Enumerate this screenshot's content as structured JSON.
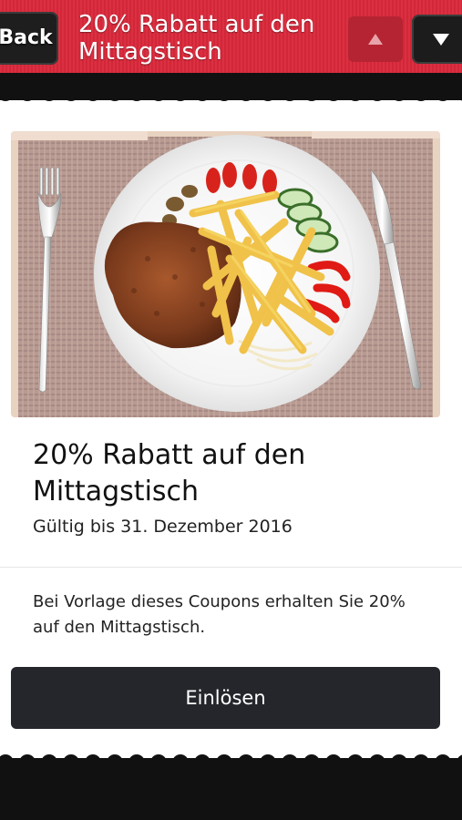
{
  "header": {
    "back_label": "Back",
    "title": "20% Rabatt auf den Mittagstisch",
    "prev_icon": "triangle-up-icon",
    "next_icon": "triangle-down-icon"
  },
  "coupon": {
    "image_alt": "Teller mit Schnitzel, Pommes frites und Salat",
    "title": "20% Rabatt auf den Mittagstisch",
    "valid_until": "Gültig bis 31. Dezember 2016",
    "description": "Bei Vorlage dieses Coupons erhalten Sie 20% auf den Mittagstisch.",
    "redeem_label": "Einlösen"
  },
  "colors": {
    "header_red": "#d8283a",
    "dark": "#111111",
    "button_dark": "#25262b"
  }
}
